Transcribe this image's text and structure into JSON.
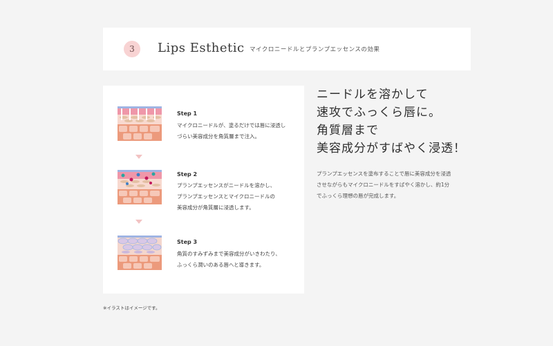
{
  "header": {
    "step_number": "3",
    "title": "Lips Esthetic",
    "subtitle": "マイクロニードルとプランプエッセンスの効果"
  },
  "steps": [
    {
      "label": "Step 1",
      "lines": [
        "マイクロニードルが、塗るだけでは唇に浸透し",
        "づらい美容成分を角質層まで注入。"
      ]
    },
    {
      "label": "Step 2",
      "lines": [
        "プランプエッセンスがニードルを溶かし、",
        "プランプエッセンスとマイクロニードルの",
        "美容成分が角質層に浸透します。"
      ]
    },
    {
      "label": "Step 3",
      "lines": [
        "角質のすみずみまで美容成分がいきわたり、",
        "ふっくら潤いのある唇へと導きます。"
      ]
    }
  ],
  "headline": [
    "ニードルを溶かして",
    "速攻でふっくら唇に。",
    "角質層まで",
    "美容成分がすばやく浸透！"
  ],
  "description": [
    "プランプエッセンスを塗布することで唇に美容成分を浸透",
    "させながらもマイクロニードルをすばやく溶かし、約1分",
    "でふっくら理想の唇が完成します。"
  ],
  "note": "※イラストはイメージです。",
  "colors": {
    "accent_pink": "#f8d3d3",
    "skin_orange": "#ec9a7c",
    "skin_light": "#f6c8b8",
    "lip_pink": "#ef97a9",
    "blue_layer": "#9fb4e3"
  }
}
